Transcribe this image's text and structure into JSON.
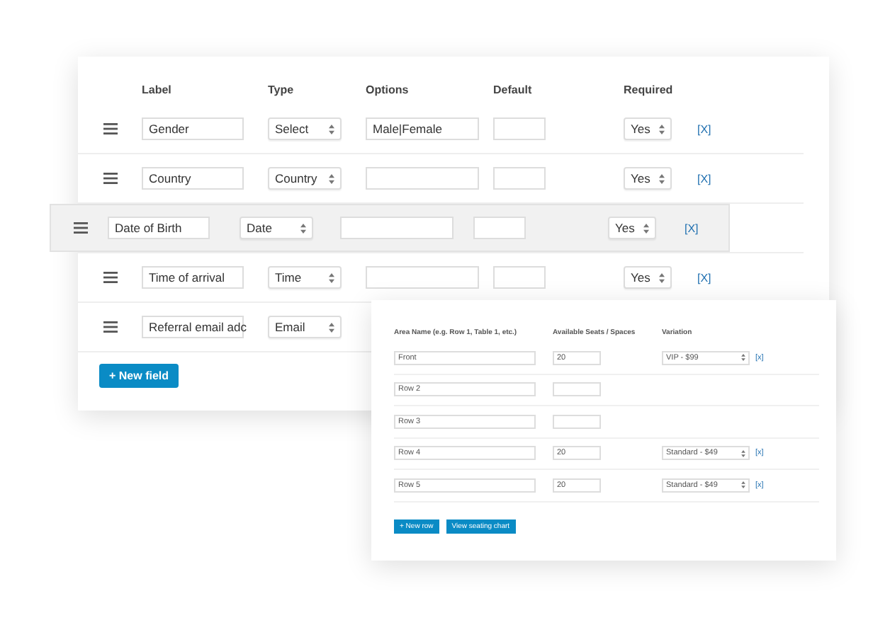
{
  "fields_table": {
    "columns": [
      "Label",
      "Type",
      "Options",
      "Default",
      "Required"
    ],
    "rows": [
      {
        "label": "Gender",
        "type": "Select",
        "options": "Male|Female",
        "required": "Yes",
        "remove": "[X]",
        "dragging": false
      },
      {
        "label": "Country",
        "type": "Country",
        "required": "Yes",
        "remove": "[X]",
        "dragging": false
      },
      {
        "label": "Date of Birth",
        "type": "Date",
        "required": "Yes",
        "remove": "[X]",
        "dragging": true
      },
      {
        "label": "Time of arrival",
        "type": "Time",
        "required": "Yes",
        "remove": "[X]",
        "dragging": false
      },
      {
        "label": "Referral email adc",
        "type": "Email",
        "dragging": false
      }
    ],
    "new_field_button": "+ New field"
  },
  "seating_table": {
    "columns": [
      "Area Name (e.g. Row 1, Table 1, etc.)",
      "Available Seats / Spaces",
      "Variation"
    ],
    "rows": [
      {
        "area": "Front",
        "seats": "20",
        "variation": "VIP - $99",
        "remove": "[x]"
      },
      {
        "area": "Row 2"
      },
      {
        "area": "Row 3"
      },
      {
        "area": "Row 4",
        "seats": "20",
        "variation": "Standard - $49",
        "remove": "[x]"
      },
      {
        "area": "Row 5",
        "seats": "20",
        "variation": "Standard - $49",
        "remove": "[x]"
      }
    ],
    "buttons": [
      "+ New row",
      "View seating chart"
    ]
  }
}
